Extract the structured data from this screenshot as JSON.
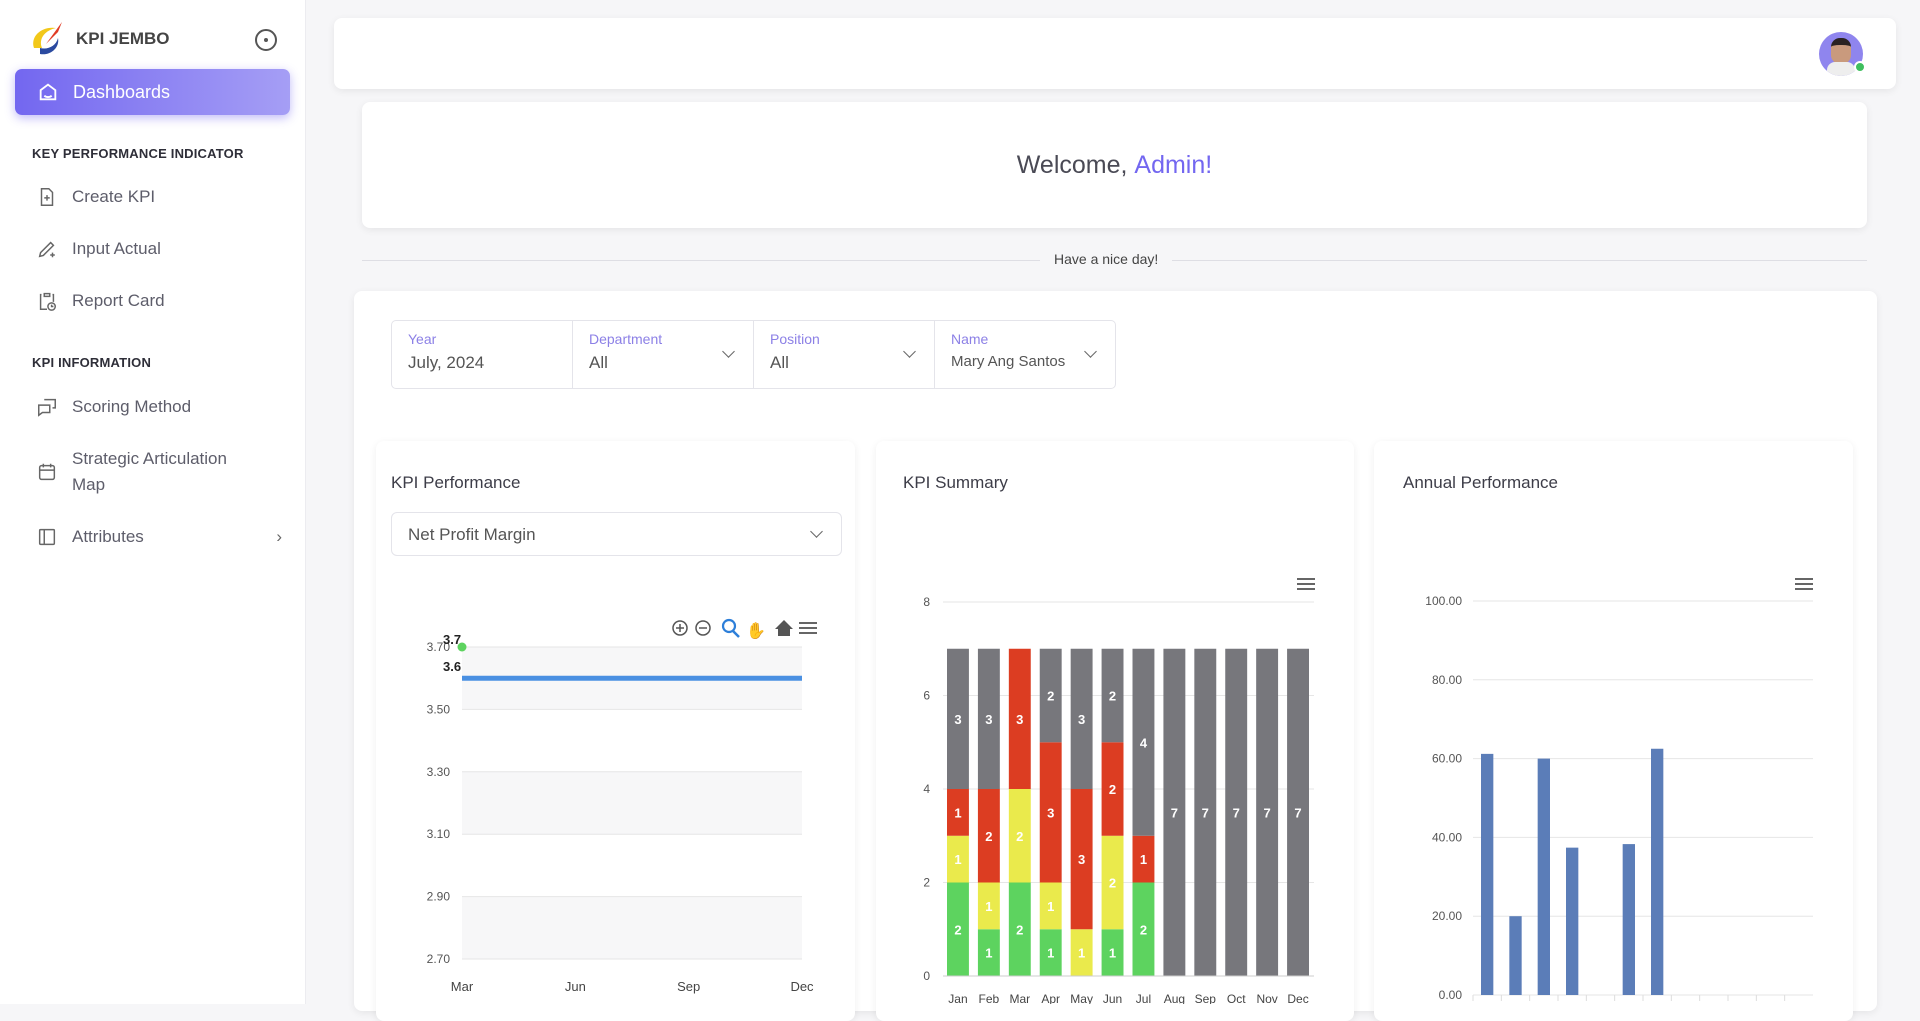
{
  "sidebar": {
    "brand": "KPI JEMBO",
    "active": {
      "label": "Dashboards",
      "icon": "home-icon"
    },
    "sections": [
      {
        "title": "KEY PERFORMANCE INDICATOR",
        "items": [
          {
            "label": "Create KPI",
            "icon": "file-plus-icon"
          },
          {
            "label": "Input Actual",
            "icon": "pencil-plus-icon"
          },
          {
            "label": "Report Card",
            "icon": "clipboard-clock-icon"
          }
        ]
      },
      {
        "title": "KPI INFORMATION",
        "items": [
          {
            "label": "Scoring Method",
            "icon": "messages-icon"
          },
          {
            "label": "Strategic Articulation Map",
            "icon": "calendar-icon"
          },
          {
            "label": "Attributes",
            "icon": "layout-sidebar-icon"
          }
        ]
      }
    ]
  },
  "welcome": {
    "prefix": "Welcome, ",
    "name": "Admin!",
    "divider_text": "Have a nice day!"
  },
  "filters": [
    {
      "label": "Year",
      "value": "July, 2024"
    },
    {
      "label": "Department",
      "value": "All"
    },
    {
      "label": "Position",
      "value": "All"
    },
    {
      "label": "Name",
      "value": "Mary Ang Santos"
    }
  ],
  "colors": {
    "accent": "#7367f0",
    "green": "#5dd35f",
    "yellow": "#eaea4c",
    "red": "#dc3d22",
    "gray": "#77777c",
    "blue_line": "#4a90e2",
    "bar_blue": "#5b7db8"
  },
  "kpi_performance": {
    "title": "KPI Performance",
    "selected_kpi": "Net Profit Margin"
  },
  "kpi_summary": {
    "title": "KPI Summary"
  },
  "annual_performance": {
    "title": "Annual Performance"
  },
  "chart_data": [
    {
      "type": "line",
      "categories": [
        "Mar",
        "Jun",
        "Sep",
        "Dec"
      ],
      "ylim": [
        2.7,
        3.7
      ],
      "yticks": [
        "3.70",
        "3.50",
        "3.30",
        "3.10",
        "2.90",
        "2.70"
      ],
      "series": [
        {
          "color": "#4a90e2",
          "values": [
            3.6,
            3.6,
            3.6,
            3.6
          ],
          "label": "3.6"
        },
        {
          "color": "#5dd35f",
          "values": [
            3.7,
            null,
            null,
            null
          ],
          "label": "3.7"
        }
      ],
      "grid": true
    },
    {
      "type": "bar",
      "stacked": true,
      "categories": [
        "Jan",
        "Feb",
        "Mar",
        "Apr",
        "May",
        "Jun",
        "Jul",
        "Aug",
        "Sep",
        "Oct",
        "Nov",
        "Dec"
      ],
      "ylim": [
        0,
        8
      ],
      "yticks": [
        "0",
        "2",
        "4",
        "6",
        "8"
      ],
      "series": [
        {
          "color": "#5dd35f",
          "values": [
            2,
            1,
            2,
            1,
            0,
            1,
            2,
            0,
            0,
            0,
            0,
            0
          ]
        },
        {
          "color": "#eaea4c",
          "values": [
            1,
            1,
            2,
            1,
            1,
            2,
            0,
            0,
            0,
            0,
            0,
            0
          ]
        },
        {
          "color": "#dc3d22",
          "values": [
            1,
            2,
            3,
            3,
            3,
            2,
            1,
            0,
            0,
            0,
            0,
            0
          ]
        },
        {
          "color": "#77777c",
          "values": [
            3,
            3,
            0,
            2,
            3,
            2,
            4,
            7,
            7,
            7,
            7,
            7
          ]
        }
      ],
      "grid": true
    },
    {
      "type": "bar",
      "ylim": [
        0,
        100
      ],
      "yticks": [
        "0.00",
        "20.00",
        "40.00",
        "60.00",
        "80.00",
        "100.00"
      ],
      "values": [
        61.2,
        20,
        60,
        37.4,
        0,
        38.3,
        62.5,
        0,
        0,
        0,
        0,
        0
      ],
      "color": "#5b7db8",
      "grid": true
    }
  ]
}
